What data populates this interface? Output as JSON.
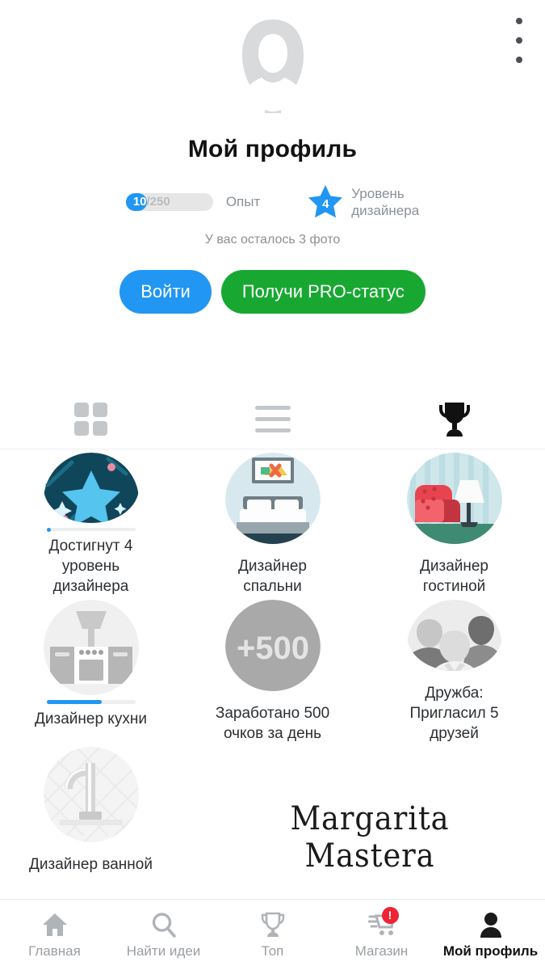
{
  "header": {
    "menu_icon": "kebab-menu-icon",
    "avatar_icon": "default-avatar-icon",
    "title": "Мой профиль"
  },
  "stats": {
    "xp_current": "10",
    "xp_total": "/250",
    "xp_label": "Опыт",
    "level_value": "4",
    "level_label": "Уровень дизайнера",
    "level_label_line1": "Уровень",
    "level_label_line2": "дизайнера",
    "photos_left": "У вас осталось 3 фото",
    "accent_blue": "#2196f3",
    "muted_gray": "#8b9096"
  },
  "actions": {
    "login_label": "Войти",
    "pro_label": "Получи PRO-статус",
    "login_color": "#2196f3",
    "pro_color": "#18a832"
  },
  "tabs": [
    {
      "name": "grid",
      "icon": "grid-icon",
      "active": false
    },
    {
      "name": "list",
      "icon": "list-lines-icon",
      "active": false
    },
    {
      "name": "achievements",
      "icon": "trophy-icon",
      "active": true
    }
  ],
  "achievements": [
    {
      "label": "Достигнут 4 уровень дизайнера",
      "icon": "star-badge-icon",
      "unlocked": true,
      "progress": 4
    },
    {
      "label": "Дизайнер спальни",
      "icon": "bedroom-icon",
      "unlocked": true,
      "progress": null
    },
    {
      "label": "Дизайнер гостиной",
      "icon": "livingroom-icon",
      "unlocked": true,
      "progress": null
    },
    {
      "label": "Дизайнер кухни",
      "icon": "kitchen-icon",
      "unlocked": false,
      "progress": 62
    },
    {
      "label": "Заработано 500 очков за день",
      "icon": "plus-500-icon",
      "unlocked": false,
      "progress": null
    },
    {
      "label": "Дружба: Пригласил 5 друзей",
      "icon": "friends-icon",
      "unlocked": false,
      "progress": null
    },
    {
      "label": "Дизайнер ванной",
      "icon": "bathroom-icon",
      "unlocked": false,
      "progress": null
    }
  ],
  "badge_texts": {
    "plus_500": "+500"
  },
  "watermark": "Margarita Mastera",
  "bottom_nav": [
    {
      "label": "Главная",
      "icon": "home-icon",
      "active": false,
      "badge": ""
    },
    {
      "label": "Найти идеи",
      "icon": "search-icon",
      "active": false,
      "badge": ""
    },
    {
      "label": "Топ",
      "icon": "trophy-icon",
      "active": false,
      "badge": ""
    },
    {
      "label": "Магазин",
      "icon": "cart-icon",
      "active": false,
      "badge": "!"
    },
    {
      "label": "Мой профиль",
      "icon": "person-icon",
      "active": true,
      "badge": ""
    }
  ]
}
